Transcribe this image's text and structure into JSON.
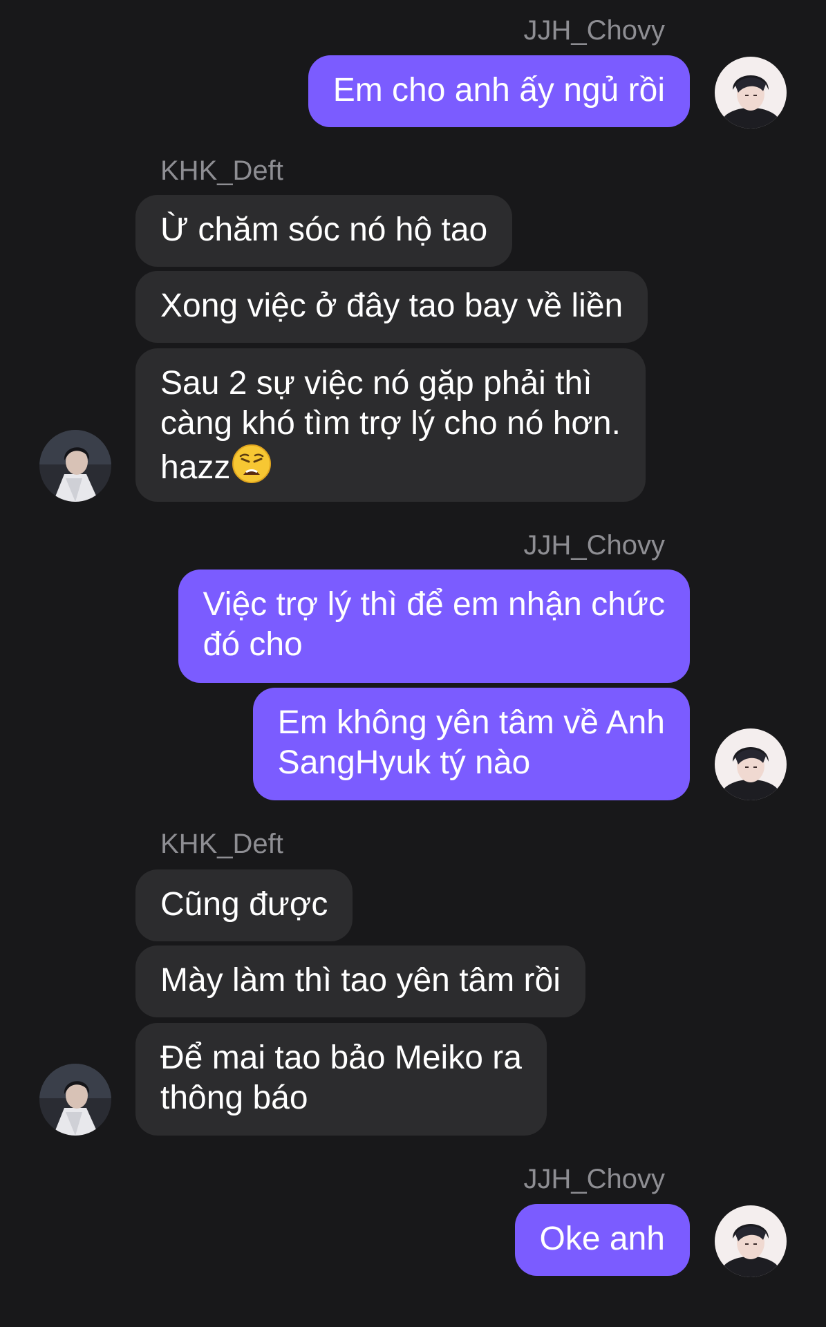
{
  "senders": {
    "me": "JJH_Chovy",
    "other": "KHK_Deft"
  },
  "groups": [
    {
      "sender_key": "me",
      "messages": [
        {
          "lines": [
            "Em cho anh ấy ngủ rồi"
          ]
        }
      ]
    },
    {
      "sender_key": "other",
      "messages": [
        {
          "lines": [
            "Ừ chăm sóc nó hộ tao"
          ]
        },
        {
          "lines": [
            "Xong việc ở đây tao bay về liền"
          ]
        },
        {
          "lines": [
            "Sau 2 sự việc nó gặp phải thì",
            "càng khó tìm trợ lý cho nó hơn.",
            "hazz"
          ],
          "emoji": "weary-face"
        }
      ]
    },
    {
      "sender_key": "me",
      "messages": [
        {
          "lines": [
            "Việc trợ lý thì để em nhận chức",
            "đó cho"
          ]
        },
        {
          "lines": [
            "Em không yên tâm về Anh",
            "SangHyuk tý nào"
          ]
        }
      ]
    },
    {
      "sender_key": "other",
      "messages": [
        {
          "lines": [
            "Cũng được"
          ]
        },
        {
          "lines": [
            "Mày làm thì tao yên tâm rồi"
          ]
        },
        {
          "lines": [
            "Để mai tao bảo Meiko ra",
            "thông báo"
          ]
        }
      ]
    },
    {
      "sender_key": "me",
      "messages": [
        {
          "lines": [
            "Oke anh"
          ]
        }
      ]
    }
  ],
  "colors": {
    "background": "#18181a",
    "outgoing_bubble": "#7b5cff",
    "incoming_bubble": "#2c2c2e",
    "sender_name": "#8e8e93",
    "text": "#ffffff"
  }
}
